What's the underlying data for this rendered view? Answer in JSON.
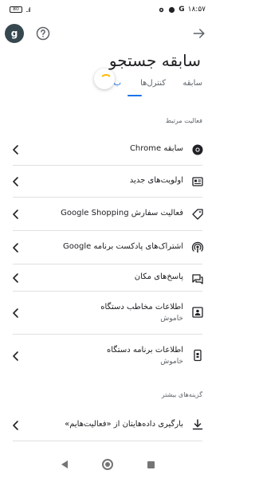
{
  "status_bar": {
    "time": "۱۸:۵۷",
    "battery": "80",
    "g_label": "G",
    "signal": "..ıl"
  },
  "header": {
    "avatar_letter": "g",
    "title": "سابقه جستجو",
    "icons": {
      "help": "help-circle-icon",
      "back": "arrow-forward-icon"
    }
  },
  "tabs": [
    {
      "label": "سابقه"
    },
    {
      "label": "کنترل‌ها"
    },
    {
      "label": "ب"
    }
  ],
  "sections": [
    {
      "header": "فعالیت مرتبط",
      "items": [
        {
          "label": "سابقه Chrome",
          "icon": "chrome-icon"
        },
        {
          "label": "اولویت‌های جدید",
          "icon": "news-icon"
        },
        {
          "label": "فعالیت سفارش Google Shopping",
          "icon": "tag-icon"
        },
        {
          "label": "اشتراک‌های پادکست برنامه Google",
          "icon": "podcast-icon"
        },
        {
          "label": "پاسخ‌های مکان",
          "icon": "chat-icon"
        },
        {
          "label": "اطلاعات مخاطب دستگاه",
          "sublabel": "خاموش",
          "icon": "contact-card-icon"
        },
        {
          "label": "اطلاعات برنامه دستگاه",
          "sublabel": "خاموش",
          "icon": "device-app-icon"
        }
      ]
    },
    {
      "header": "گزینه‌های بیشتر",
      "items": [
        {
          "label": "بارگیری داده‌هایتان از «فعالیت‌هایم»",
          "icon": "download-icon"
        }
      ]
    }
  ],
  "nav_bar": {
    "icons": [
      "nav-back-icon",
      "nav-home-icon",
      "nav-recent-icon"
    ]
  },
  "colors": {
    "accent": "#1a73e8",
    "text": "#202124",
    "secondary": "#5f6368",
    "divider": "#e0e0e0"
  }
}
